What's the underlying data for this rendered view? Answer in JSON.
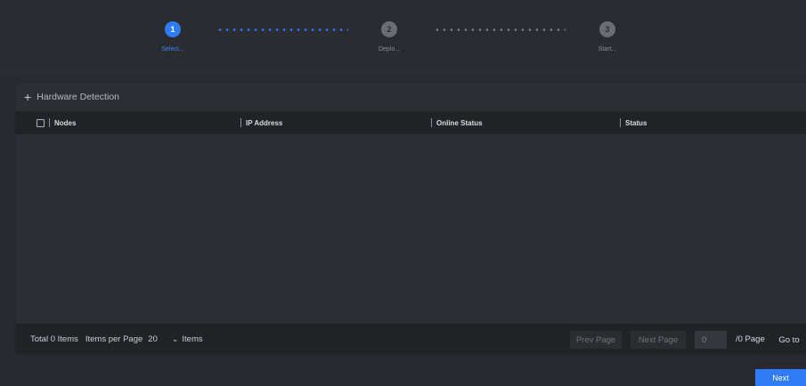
{
  "steps": [
    {
      "number": "1",
      "label": "Select...",
      "state": "active"
    },
    {
      "number": "2",
      "label": "Deplo...",
      "state": "inactive"
    },
    {
      "number": "3",
      "label": "Start...",
      "state": "inactive"
    }
  ],
  "colors": {
    "accent": "#2f7cf6",
    "background": "#27292e",
    "panel": "#2c2e33",
    "header": "#212327"
  },
  "panel": {
    "add_label": "Hardware Detection",
    "add_icon": "plus-icon"
  },
  "table": {
    "columns": [
      "Nodes",
      "IP Address",
      "Online Status",
      "Status"
    ],
    "rows": []
  },
  "pagination": {
    "total": "Total 0 Items",
    "per_page_label": "Items per Page",
    "per_page_value": "20",
    "items_label": "Items",
    "prev": "Prev Page",
    "next": "Next Page",
    "page_input": "0",
    "page_total": "/0 Page",
    "goto": "Go to"
  },
  "actions": {
    "next": "Next"
  }
}
